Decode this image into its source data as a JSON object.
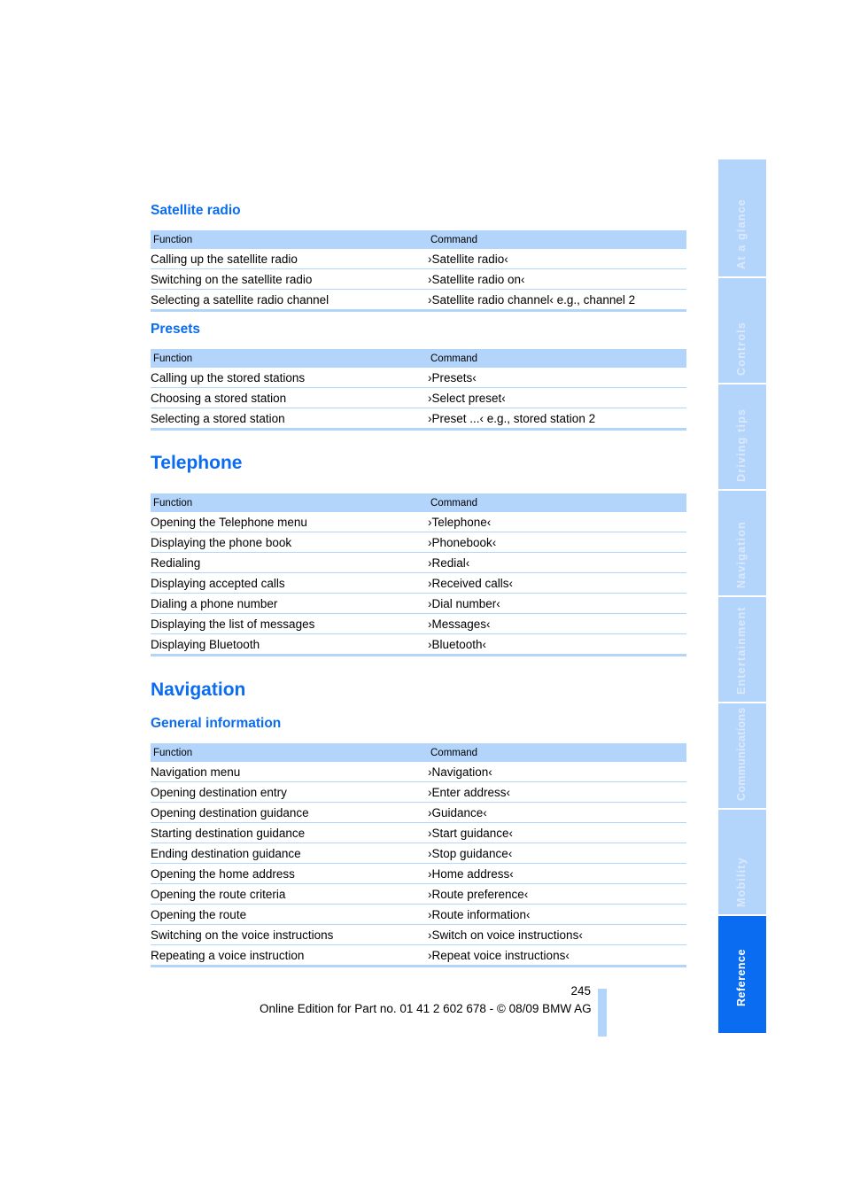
{
  "sections": {
    "satellite_radio": {
      "title": "Satellite radio",
      "headers": [
        "Function",
        "Command"
      ],
      "rows": [
        [
          "Calling up the satellite radio",
          "›Satellite radio‹"
        ],
        [
          "Switching on the satellite radio",
          "›Satellite radio on‹"
        ],
        [
          "Selecting a satellite radio channel",
          "›Satellite radio channel‹  e.g., channel 2"
        ]
      ]
    },
    "presets": {
      "title": "Presets",
      "headers": [
        "Function",
        "Command"
      ],
      "rows": [
        [
          "Calling up the stored stations",
          "›Presets‹"
        ],
        [
          "Choosing a stored station",
          "›Select preset‹"
        ],
        [
          "Selecting a stored station",
          "›Preset ...‹  e.g., stored station 2"
        ]
      ]
    },
    "telephone": {
      "title": "Telephone",
      "headers": [
        "Function",
        "Command"
      ],
      "rows": [
        [
          "Opening the Telephone menu",
          "›Telephone‹"
        ],
        [
          "Displaying the phone book",
          "›Phonebook‹"
        ],
        [
          "Redialing",
          "›Redial‹"
        ],
        [
          "Displaying accepted calls",
          "›Received calls‹"
        ],
        [
          "Dialing a phone number",
          "›Dial number‹"
        ],
        [
          "Displaying the list of messages",
          "›Messages‹"
        ],
        [
          "Displaying Bluetooth",
          "›Bluetooth‹"
        ]
      ]
    },
    "navigation": {
      "title": "Navigation",
      "subtitle": "General information",
      "headers": [
        "Function",
        "Command"
      ],
      "rows": [
        [
          "Navigation menu",
          "›Navigation‹"
        ],
        [
          "Opening destination entry",
          "›Enter address‹"
        ],
        [
          "Opening destination guidance",
          "›Guidance‹"
        ],
        [
          "Starting destination guidance",
          "›Start guidance‹"
        ],
        [
          "Ending destination guidance",
          "›Stop guidance‹"
        ],
        [
          "Opening the home address",
          "›Home address‹"
        ],
        [
          "Opening the route criteria",
          "›Route preference‹"
        ],
        [
          "Opening the route",
          "›Route information‹"
        ],
        [
          "Switching on the voice instructions",
          "›Switch on voice instructions‹"
        ],
        [
          "Repeating a voice instruction",
          "›Repeat voice instructions‹"
        ]
      ]
    }
  },
  "side_tabs": [
    {
      "label": "At a glance",
      "active": false
    },
    {
      "label": "Controls",
      "active": false
    },
    {
      "label": "Driving tips",
      "active": false
    },
    {
      "label": "Navigation",
      "active": false
    },
    {
      "label": "Entertainment",
      "active": false
    },
    {
      "label": "Communications",
      "active": false
    },
    {
      "label": "Mobility",
      "active": false
    },
    {
      "label": "Reference",
      "active": true
    }
  ],
  "footer": {
    "page_number": "245",
    "edition_text": "Online Edition for Part no. 01 41 2 602 678 - © 08/09 BMW AG"
  },
  "colors": {
    "accent": "#0a6cf0",
    "table_header": "#b3d4fb"
  }
}
